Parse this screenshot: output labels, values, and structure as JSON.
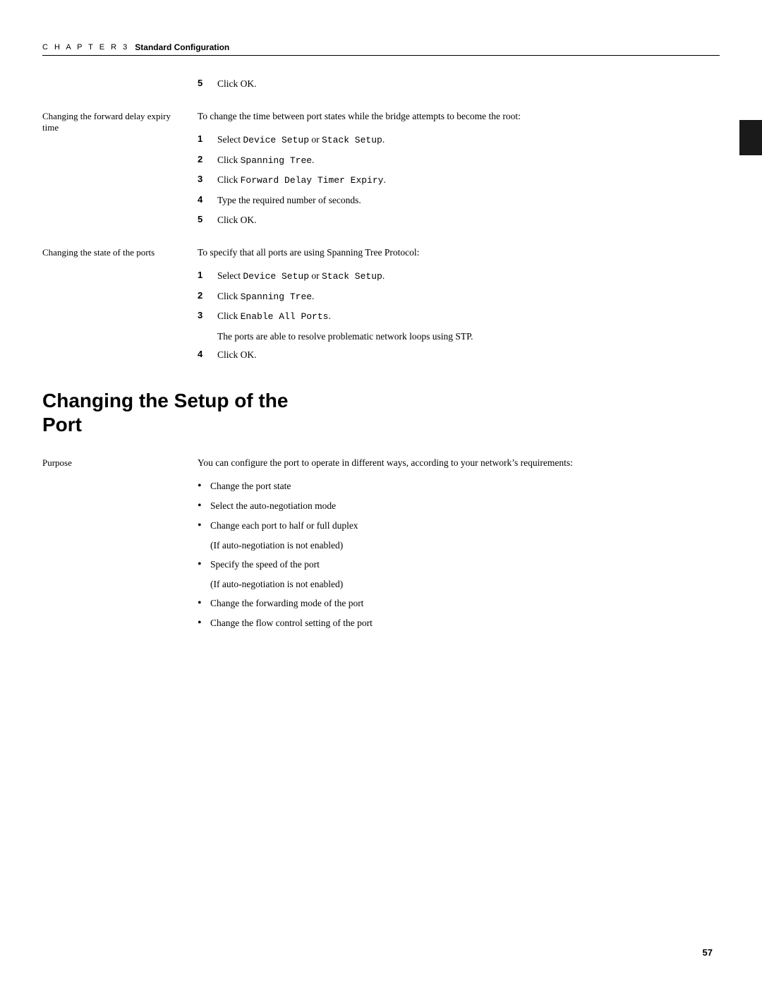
{
  "chapter": {
    "label": "C H A P T E R  3",
    "title": "Standard Configuration"
  },
  "section1": {
    "step5_click_ok": "Click OK.",
    "left_label_1": "Changing the forward delay expiry time",
    "intro_1": "To change the time between port states while the bridge attempts to become the root:",
    "steps_1": [
      {
        "number": "1",
        "text": "Select ",
        "code": "Device Setup",
        "mid": " or ",
        "code2": "Stack Setup",
        "end": "."
      },
      {
        "number": "2",
        "text": "Click ",
        "code": "Spanning Tree",
        "end": "."
      },
      {
        "number": "3",
        "text": "Click ",
        "code": "Forward Delay Timer Expiry",
        "end": "."
      },
      {
        "number": "4",
        "text": "Type the required number of seconds."
      },
      {
        "number": "5",
        "text": "Click OK."
      }
    ],
    "left_label_2": "Changing the state of the ports",
    "intro_2": "To specify that all ports are using Spanning Tree Protocol:",
    "steps_2": [
      {
        "number": "1",
        "text": "Select ",
        "code": "Device Setup",
        "mid": " or ",
        "code2": "Stack Setup",
        "end": "."
      },
      {
        "number": "2",
        "text": "Click ",
        "code": "Spanning Tree",
        "end": "."
      },
      {
        "number": "3",
        "text": "Click ",
        "code": "Enable All Ports",
        "end": "."
      }
    ],
    "note_text": "The ports are able to resolve problematic network loops using STP.",
    "step4_click_ok": "Click OK."
  },
  "section2": {
    "heading_line1": "Changing the Setup of the",
    "heading_line2": "Port",
    "purpose_label": "Purpose",
    "intro": "You can configure the port to operate in different ways, according to your network’s requirements:",
    "bullets": [
      {
        "text": "Change the port state"
      },
      {
        "text": "Select the auto-negotiation mode"
      },
      {
        "text": "Change each port to half or full duplex"
      },
      {
        "sub": "(If auto-negotiation is not enabled)"
      },
      {
        "text": "Specify the speed of the port"
      },
      {
        "sub": "(If auto-negotiation is not enabled)"
      },
      {
        "text": "Change the forwarding mode of the port"
      },
      {
        "text": "Change the flow control setting of the port"
      }
    ]
  },
  "page_number": "57"
}
